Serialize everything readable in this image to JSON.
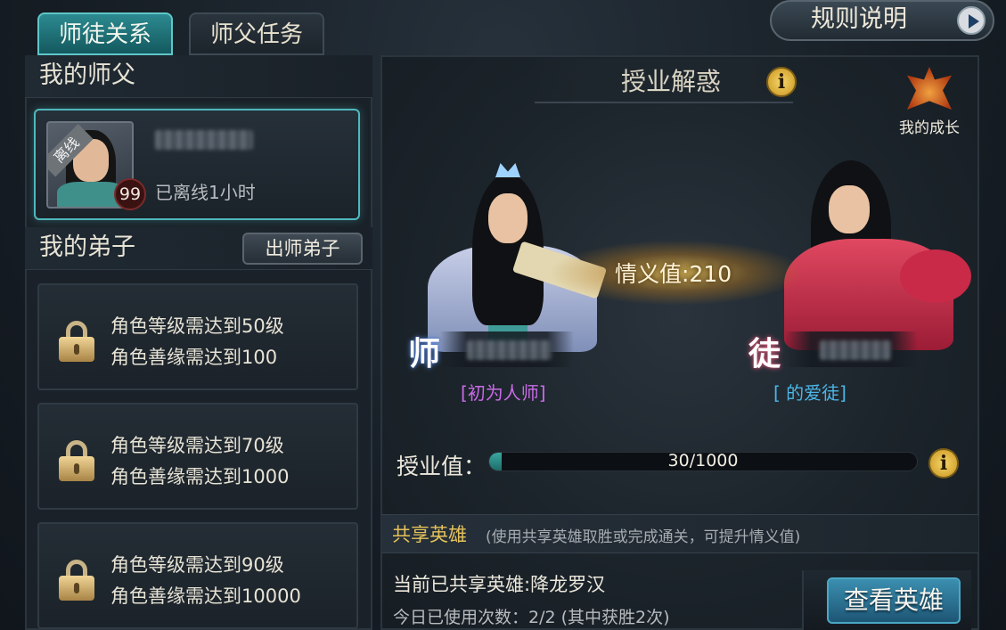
{
  "tabs": [
    {
      "label": "师徒关系",
      "active": true
    },
    {
      "label": "师父任务",
      "active": false
    }
  ],
  "rules_button": {
    "label": "规则说明"
  },
  "left": {
    "master_header": "我的师父",
    "master_card": {
      "offline_ribbon": "离线",
      "level": "99",
      "status": "已离线1小时"
    },
    "disciples_header": "我的弟子",
    "graduate_button": "出师弟子",
    "locked_slots": [
      {
        "line1": "角色等级需达到50级",
        "line2": "角色善缘需达到100"
      },
      {
        "line1": "角色等级需达到70级",
        "line2": "角色善缘需达到1000"
      },
      {
        "line1": "角色等级需达到90级",
        "line2": "角色善缘需达到10000"
      }
    ]
  },
  "right": {
    "title": "授业解惑",
    "info_icon": "i",
    "growth_label": "我的成长",
    "affection": "情义值:210",
    "master_badge": "师",
    "disciple_badge": "徒",
    "master_title_tag": "[初为人师]",
    "disciple_title_tag": "[ 的爱徒]",
    "progress": {
      "label": "授业值：",
      "current": 30,
      "max": 1000,
      "text": "30/1000"
    },
    "share": {
      "title": "共享英雄",
      "description": "(使用共享英雄取胜或完成通关，可提升情义值)",
      "current_hero": "当前已共享英雄:降龙罗汉",
      "usage": "今日已使用次数：2/2 (其中获胜2次)",
      "view_button": "查看英雄"
    }
  },
  "colors": {
    "accent_teal": "#4fb8bd",
    "master_tag": "#c86be6",
    "disciple_tag": "#4cb6e6",
    "share_title": "#e6c25a",
    "info_gold": "#f5d66a"
  },
  "icons": {
    "rules": "play-arrow-icon",
    "lock": "padlock-icon",
    "info": "info-icon",
    "growth": "growth-emblem-icon"
  }
}
